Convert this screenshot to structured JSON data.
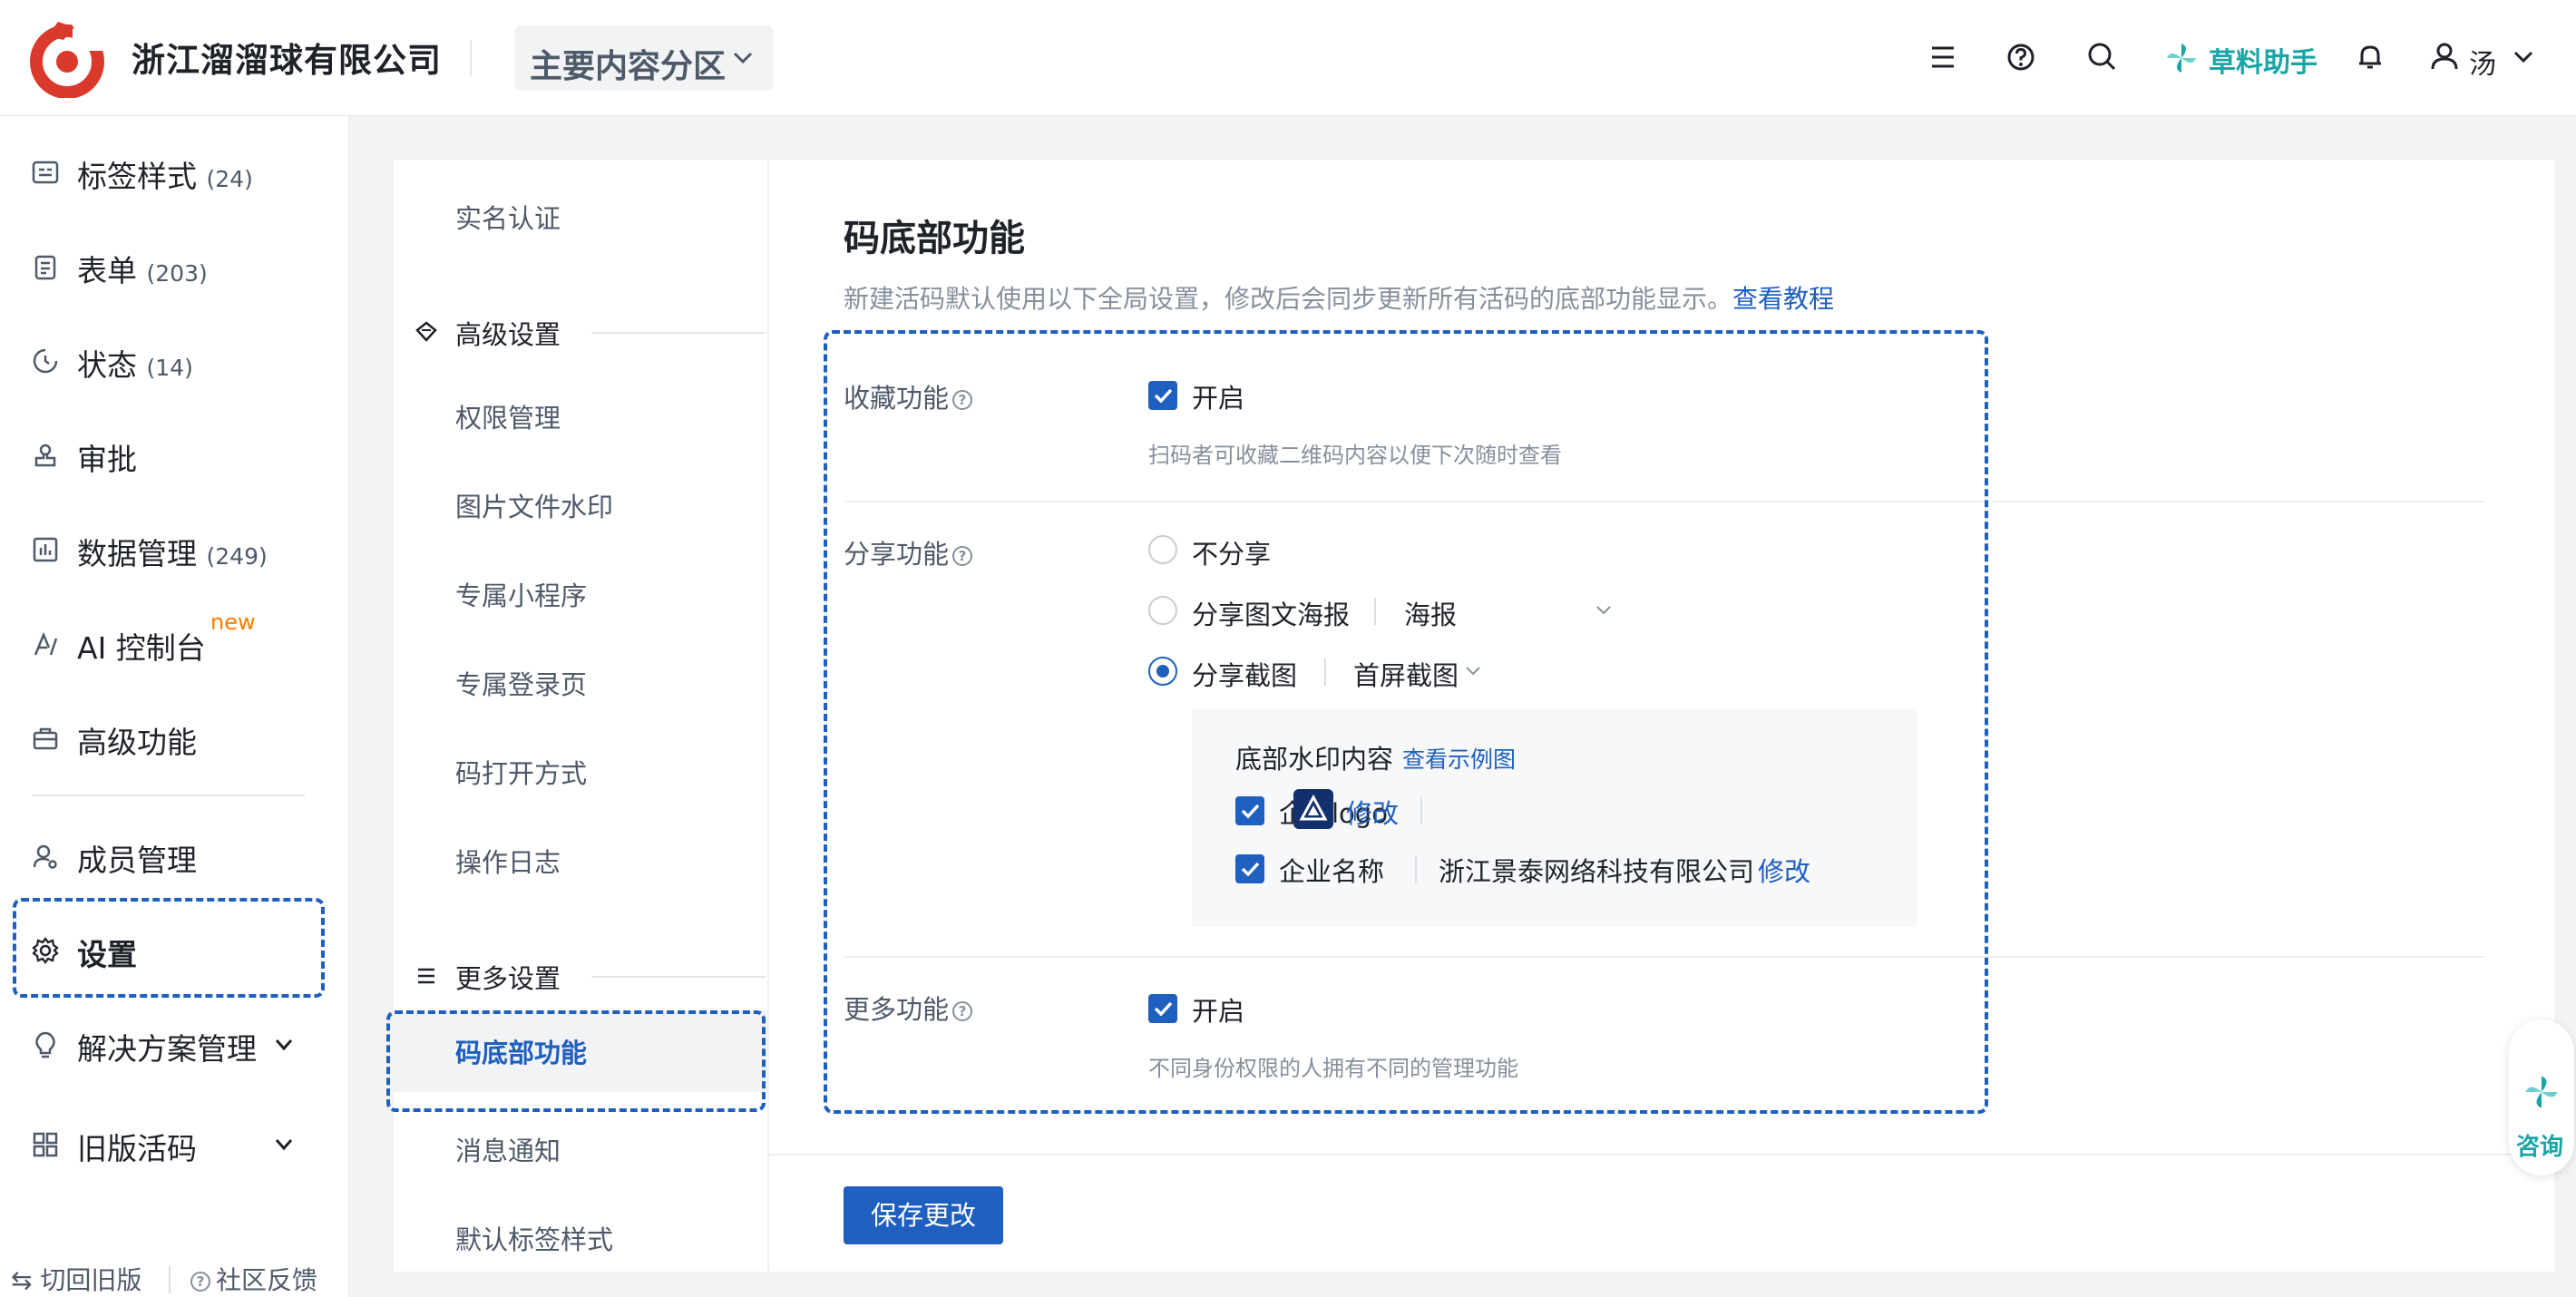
{
  "header": {
    "company": "浙江溜溜球有限公司",
    "section": "主要内容分区",
    "assistant": "草料助手",
    "user": "汤"
  },
  "sidebar": {
    "items": [
      {
        "label": "标签样式",
        "count": "(24)"
      },
      {
        "label": "表单",
        "count": "(203)"
      },
      {
        "label": "状态",
        "count": "(14)"
      },
      {
        "label": "审批",
        "count": ""
      },
      {
        "label": "数据管理",
        "count": "(249)"
      },
      {
        "label": "AI 控制台",
        "count": "",
        "badge": "new"
      },
      {
        "label": "高级功能",
        "count": ""
      },
      {
        "label": "成员管理",
        "count": ""
      },
      {
        "label": "设置",
        "count": ""
      },
      {
        "label": "解决方案管理",
        "count": ""
      },
      {
        "label": "旧版活码",
        "count": ""
      }
    ],
    "bottom": {
      "back": "切回旧版",
      "feedback": "社区反馈"
    }
  },
  "subnav": {
    "realname": "实名认证",
    "advanced_group": "高级设置",
    "advanced": [
      "权限管理",
      "图片文件水印",
      "专属小程序",
      "专属登录页",
      "码打开方式",
      "操作日志"
    ],
    "more_group": "更多设置",
    "active": "码底部功能",
    "more": [
      "消息通知",
      "默认标签样式"
    ]
  },
  "main": {
    "title": "码底部功能",
    "desc": "新建活码默认使用以下全局设置，修改后会同步更新所有活码的底部功能显示。",
    "tutorial": "查看教程",
    "favorite": {
      "label": "收藏功能",
      "option": "开启",
      "hint": "扫码者可收藏二维码内容以便下次随时查看"
    },
    "share": {
      "label": "分享功能",
      "options": [
        "不分享",
        "分享图文海报",
        "分享截图"
      ],
      "poster_select": "海报",
      "screenshot_select": "首屏截图",
      "watermark_title": "底部水印内容",
      "example_link": "查看示例图",
      "logo_label": "企业logo",
      "name_label": "企业名称",
      "company_name": "浙江景泰网络科技有限公司",
      "modify": "修改"
    },
    "more": {
      "label": "更多功能",
      "option": "开启",
      "hint": "不同身份权限的人拥有不同的管理功能"
    },
    "save": "保存更改"
  },
  "float": {
    "consult": "咨询"
  },
  "colors": {
    "accent": "#1e5fbf",
    "brand_red": "#d93a2b",
    "teal": "#19a5a6"
  }
}
